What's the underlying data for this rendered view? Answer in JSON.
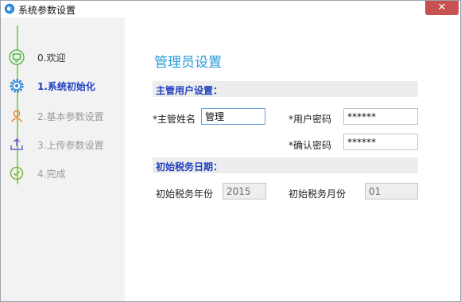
{
  "window": {
    "title": "系统参数设置",
    "close_label": "✕"
  },
  "steps": [
    {
      "label": "0.欢迎",
      "icon": "monitor-icon",
      "state": "done"
    },
    {
      "label": "1.系统初始化",
      "icon": "gear-icon",
      "state": "active"
    },
    {
      "label": "2.基本参数设置",
      "icon": "user-icon",
      "state": "disabled"
    },
    {
      "label": "3.上传参数设置",
      "icon": "upload-icon",
      "state": "disabled"
    },
    {
      "label": "4.完成",
      "icon": "check-circle-icon",
      "state": "disabled"
    }
  ],
  "main": {
    "heading": "管理员设置",
    "section_user": "主管用户设置：",
    "name_label": "*主管姓名",
    "name_value": "管理",
    "pwd_label": "*用户密码",
    "pwd_value": "******",
    "confirm_label": "*确认密码",
    "confirm_value": "******",
    "section_tax": "初始税务日期：",
    "tax_year_label": "初始税务年份",
    "tax_year_value": "2015",
    "tax_month_label": "初始税务月份",
    "tax_month_value": "01"
  },
  "colors": {
    "accent": "#2a9bd6",
    "active_step": "#1f3fbf",
    "timeline": "#8fcf6a",
    "close": "#c75050"
  }
}
